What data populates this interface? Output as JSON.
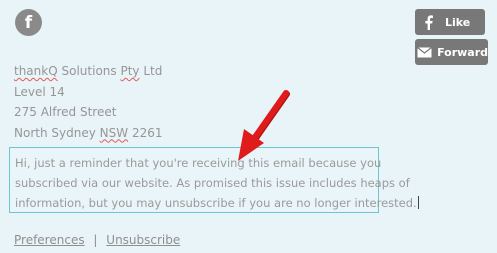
{
  "social": {
    "facebook_glyph": "f",
    "like_label": "Like",
    "forward_label": "Forward"
  },
  "address": {
    "company_part1": "thankQ",
    "company_part2": "Solutions",
    "company_part3": "Pty",
    "company_part4": "Ltd",
    "line2": "Level 14",
    "line3": "275 Alfred Street",
    "line4_city": "North Sydney",
    "line4_state": "NSW",
    "line4_postcode": "2261"
  },
  "notice": {
    "line1": "Hi, just a reminder that you're receiving this email because you",
    "line2": "subscribed via our website. As promised this issue includes heaps of",
    "line3": "information, but you may unsubscribe if you are no longer interested."
  },
  "footer": {
    "preferences_label": "Preferences",
    "separator": "|",
    "unsubscribe_label": "Unsubscribe"
  },
  "colors": {
    "background": "#e9f4f8",
    "button_gray": "#787878",
    "highlight_border": "#6fc5cf",
    "annotation_arrow": "#e01b1b",
    "spellcheck_underline": "#e05b5b"
  }
}
